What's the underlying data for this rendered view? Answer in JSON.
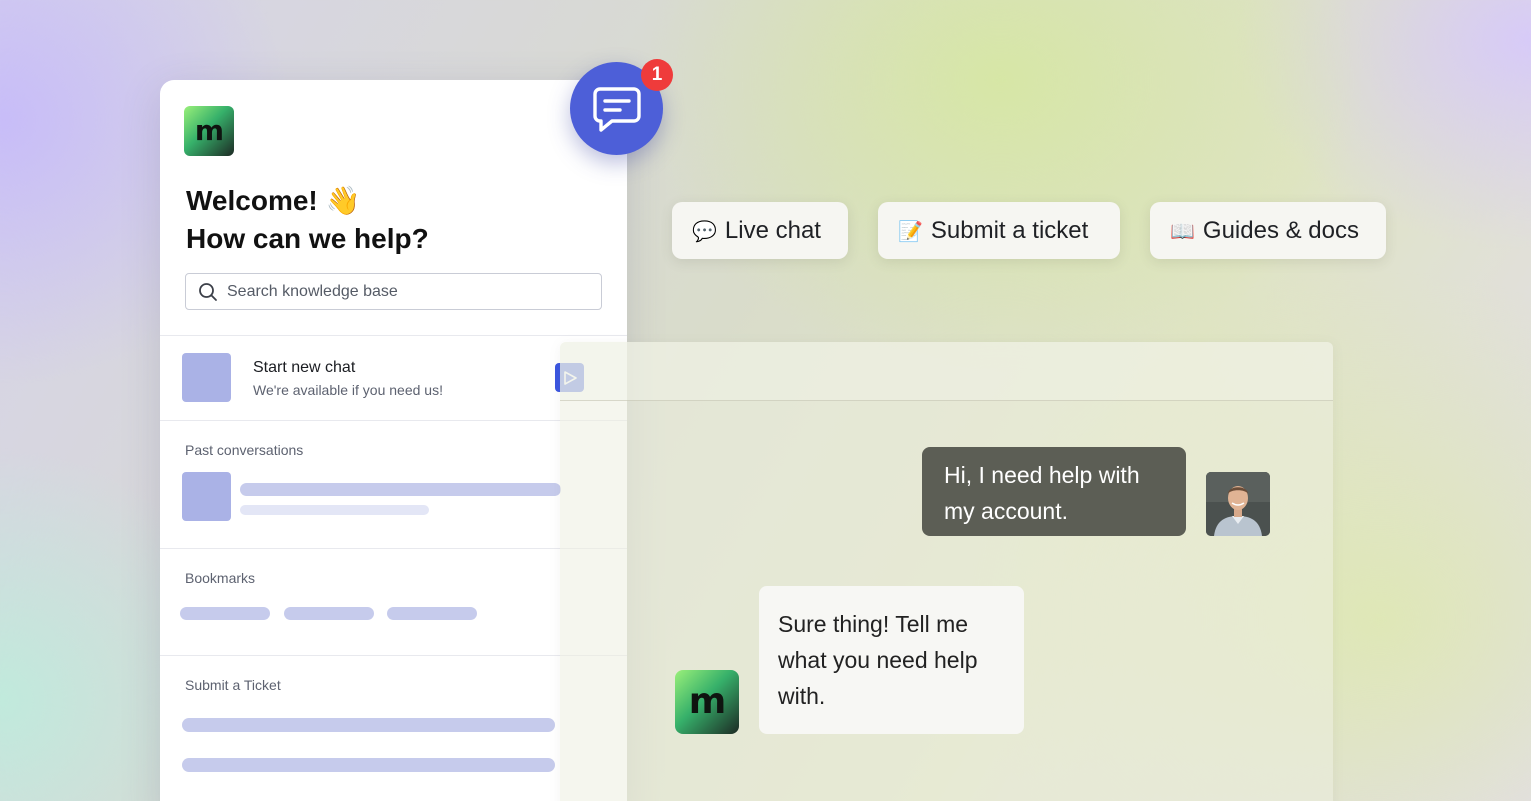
{
  "widget": {
    "logo_letter": "m",
    "welcome_line1": "Welcome! 👋",
    "welcome_line2": "How can we help?",
    "search_placeholder": "Search knowledge base",
    "start_chat_title": "Start new chat",
    "start_chat_subtitle": "We're available if you need us!",
    "past_conversations_label": "Past conversations",
    "bookmarks_label": "Bookmarks",
    "submit_ticket_label": "Submit a Ticket"
  },
  "launcher": {
    "icon": "chat-bubble-icon",
    "badge_count": "1"
  },
  "pills": [
    {
      "emoji": "💬",
      "label": "Live chat"
    },
    {
      "emoji": "📝",
      "label": "Submit a ticket"
    },
    {
      "emoji": "📖",
      "label": "Guides & docs"
    }
  ],
  "chat": {
    "user_message": "Hi, I need help with my account.",
    "agent_message": "Sure thing! Tell me what you need help with.",
    "agent_logo_letter": "m"
  },
  "colors": {
    "accent": "#3a55e0",
    "launcher": "#4d5fd8",
    "badge": "#ef3b3b",
    "user_bubble": "#5c5e55"
  }
}
